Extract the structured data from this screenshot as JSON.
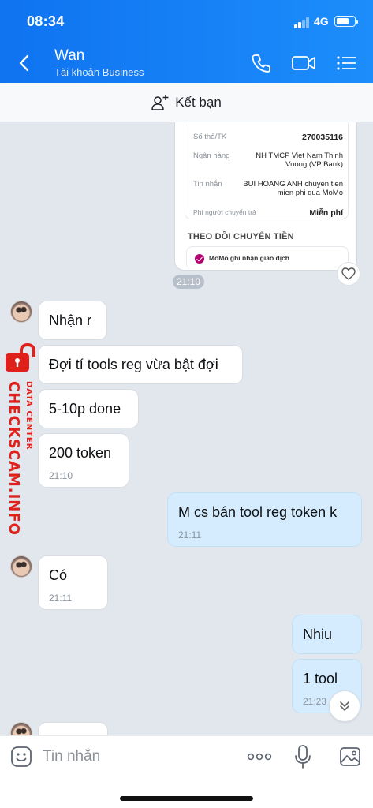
{
  "status": {
    "time": "08:34",
    "network": "4G"
  },
  "header": {
    "name": "Wan",
    "subtitle": "Tài khoản Business"
  },
  "friend_bar": {
    "label": "Kết bạn"
  },
  "receipt": {
    "rows": [
      {
        "key": "Số thẻ/TK",
        "value": "270035116"
      },
      {
        "key": "Ngân hàng",
        "value": "NH TMCP Viet Nam Thinh Vuong (VP Bank)"
      },
      {
        "key": "Tin nhắn",
        "value": "BUI HOANG ANH chuyen tien mien phi qua MoMo"
      },
      {
        "key": "Phí người chuyển trả",
        "value": "Miễn phí"
      }
    ],
    "section_title": "THEO DÕI CHUYỂN TIỀN",
    "tracking_text": "MoMo ghi nhận giao dịch",
    "time": "21:10"
  },
  "messages": [
    {
      "text": "Nhận r",
      "time": ""
    },
    {
      "text": "Đợi tí tools reg vừa bật đợi",
      "time": ""
    },
    {
      "text": "5-10p done",
      "time": ""
    },
    {
      "text": "200 token",
      "time": "21:10"
    },
    {
      "text": "M cs bán tool reg token k",
      "time": "21:11"
    },
    {
      "text": "Có",
      "time": "21:11"
    },
    {
      "text": "Nhiu",
      "time": ""
    },
    {
      "text": "1 tool",
      "time": "21:23"
    }
  ],
  "watermark": {
    "brand": "CHECKSCAM.INFO",
    "sub": "DATA CENTER"
  },
  "input": {
    "placeholder": "Tin nhắn"
  },
  "icons": [
    "back-icon",
    "phone-icon",
    "video-icon",
    "menu-icon",
    "add-friend-icon",
    "heart-icon",
    "sticker-icon",
    "more-icon",
    "mic-icon",
    "image-icon",
    "chevron-down-icon"
  ],
  "colors": {
    "header": "#1183f5",
    "outgoing_bubble": "#d4ecfd",
    "chat_bg": "#e2e7ee",
    "watermark": "#e0201b"
  }
}
